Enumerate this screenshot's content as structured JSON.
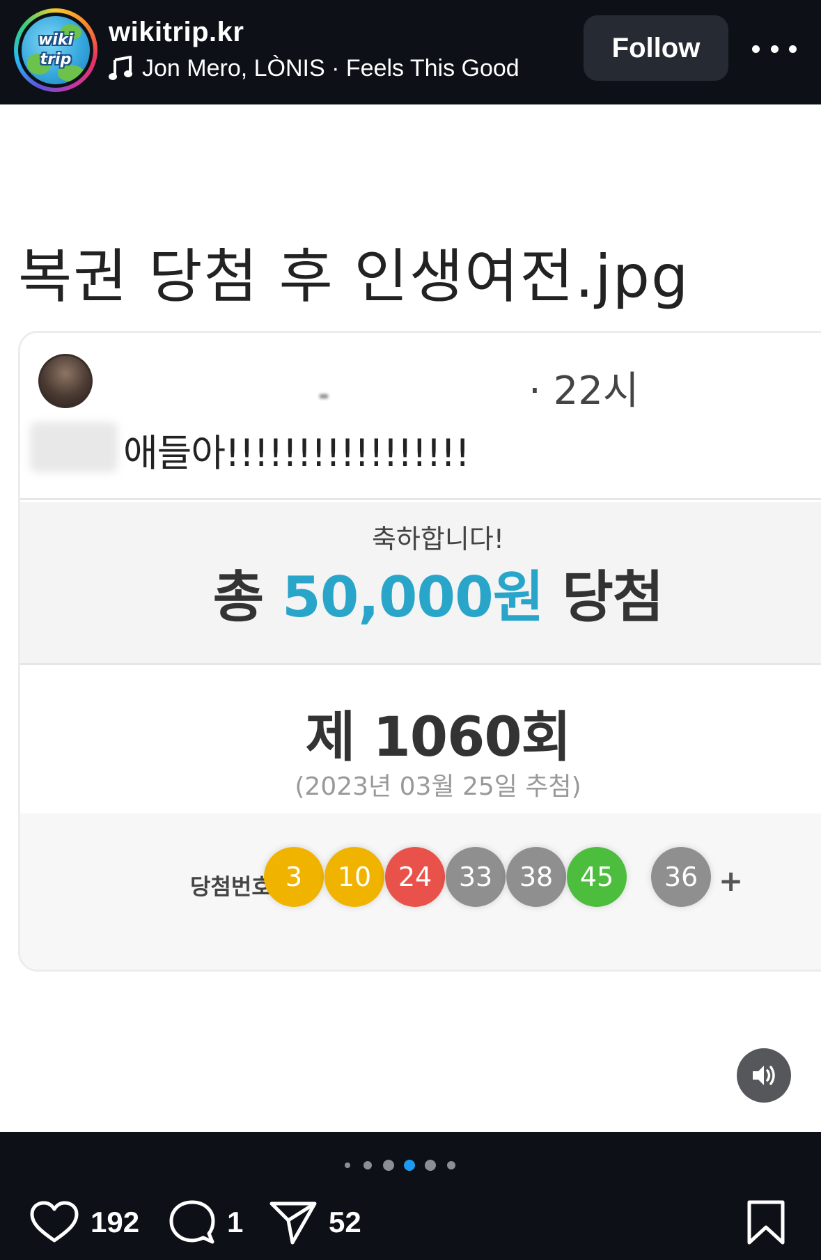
{
  "header": {
    "account_name": "wikitrip.kr",
    "avatar_text_top": "wiki",
    "avatar_text_bottom": "trip",
    "music": "Jon Mero, LÒNIS · Feels This Good",
    "follow_label": "Follow"
  },
  "post": {
    "title": "복권 당첨 후 인생여전.jpg",
    "card": {
      "time": "· 22시",
      "message": "애들아!!!!!!!!!!!!!!!!!",
      "congrats": "축하합니다!",
      "prize_prefix": "총 ",
      "prize_amount": "50,000원",
      "prize_suffix": " 당첨",
      "round": "제 1060회",
      "draw_date": "(2023년 03월 25일 추첨)",
      "numbers_label": "당첨번호",
      "numbers": [
        "3",
        "10",
        "24",
        "33",
        "38",
        "45"
      ],
      "plus": "+",
      "bonus": "36",
      "ball_colors": [
        "#f0b400",
        "#f0b400",
        "#e8524a",
        "#8f8f8f",
        "#8f8f8f",
        "#4cbd3c",
        "#8f8f8f"
      ]
    }
  },
  "actions": {
    "likes": "192",
    "comments": "1",
    "shares": "52",
    "carousel_active_index": 3,
    "carousel_count": 6
  },
  "colors": {
    "background": "#0d1117",
    "follow_bg": "#262b33",
    "carousel_active": "#1d9bf0",
    "prize_accent": "#29a5c9"
  }
}
